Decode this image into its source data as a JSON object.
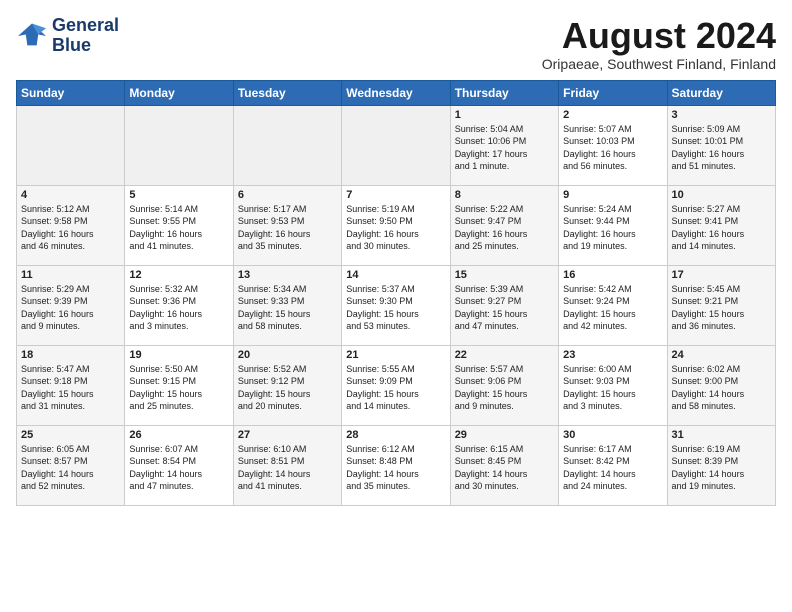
{
  "header": {
    "logo_line1": "General",
    "logo_line2": "Blue",
    "month_year": "August 2024",
    "location": "Oripaeae, Southwest Finland, Finland"
  },
  "weekdays": [
    "Sunday",
    "Monday",
    "Tuesday",
    "Wednesday",
    "Thursday",
    "Friday",
    "Saturday"
  ],
  "weeks": [
    [
      {
        "day": "",
        "info": ""
      },
      {
        "day": "",
        "info": ""
      },
      {
        "day": "",
        "info": ""
      },
      {
        "day": "",
        "info": ""
      },
      {
        "day": "1",
        "info": "Sunrise: 5:04 AM\nSunset: 10:06 PM\nDaylight: 17 hours\nand 1 minute."
      },
      {
        "day": "2",
        "info": "Sunrise: 5:07 AM\nSunset: 10:03 PM\nDaylight: 16 hours\nand 56 minutes."
      },
      {
        "day": "3",
        "info": "Sunrise: 5:09 AM\nSunset: 10:01 PM\nDaylight: 16 hours\nand 51 minutes."
      }
    ],
    [
      {
        "day": "4",
        "info": "Sunrise: 5:12 AM\nSunset: 9:58 PM\nDaylight: 16 hours\nand 46 minutes."
      },
      {
        "day": "5",
        "info": "Sunrise: 5:14 AM\nSunset: 9:55 PM\nDaylight: 16 hours\nand 41 minutes."
      },
      {
        "day": "6",
        "info": "Sunrise: 5:17 AM\nSunset: 9:53 PM\nDaylight: 16 hours\nand 35 minutes."
      },
      {
        "day": "7",
        "info": "Sunrise: 5:19 AM\nSunset: 9:50 PM\nDaylight: 16 hours\nand 30 minutes."
      },
      {
        "day": "8",
        "info": "Sunrise: 5:22 AM\nSunset: 9:47 PM\nDaylight: 16 hours\nand 25 minutes."
      },
      {
        "day": "9",
        "info": "Sunrise: 5:24 AM\nSunset: 9:44 PM\nDaylight: 16 hours\nand 19 minutes."
      },
      {
        "day": "10",
        "info": "Sunrise: 5:27 AM\nSunset: 9:41 PM\nDaylight: 16 hours\nand 14 minutes."
      }
    ],
    [
      {
        "day": "11",
        "info": "Sunrise: 5:29 AM\nSunset: 9:39 PM\nDaylight: 16 hours\nand 9 minutes."
      },
      {
        "day": "12",
        "info": "Sunrise: 5:32 AM\nSunset: 9:36 PM\nDaylight: 16 hours\nand 3 minutes."
      },
      {
        "day": "13",
        "info": "Sunrise: 5:34 AM\nSunset: 9:33 PM\nDaylight: 15 hours\nand 58 minutes."
      },
      {
        "day": "14",
        "info": "Sunrise: 5:37 AM\nSunset: 9:30 PM\nDaylight: 15 hours\nand 53 minutes."
      },
      {
        "day": "15",
        "info": "Sunrise: 5:39 AM\nSunset: 9:27 PM\nDaylight: 15 hours\nand 47 minutes."
      },
      {
        "day": "16",
        "info": "Sunrise: 5:42 AM\nSunset: 9:24 PM\nDaylight: 15 hours\nand 42 minutes."
      },
      {
        "day": "17",
        "info": "Sunrise: 5:45 AM\nSunset: 9:21 PM\nDaylight: 15 hours\nand 36 minutes."
      }
    ],
    [
      {
        "day": "18",
        "info": "Sunrise: 5:47 AM\nSunset: 9:18 PM\nDaylight: 15 hours\nand 31 minutes."
      },
      {
        "day": "19",
        "info": "Sunrise: 5:50 AM\nSunset: 9:15 PM\nDaylight: 15 hours\nand 25 minutes."
      },
      {
        "day": "20",
        "info": "Sunrise: 5:52 AM\nSunset: 9:12 PM\nDaylight: 15 hours\nand 20 minutes."
      },
      {
        "day": "21",
        "info": "Sunrise: 5:55 AM\nSunset: 9:09 PM\nDaylight: 15 hours\nand 14 minutes."
      },
      {
        "day": "22",
        "info": "Sunrise: 5:57 AM\nSunset: 9:06 PM\nDaylight: 15 hours\nand 9 minutes."
      },
      {
        "day": "23",
        "info": "Sunrise: 6:00 AM\nSunset: 9:03 PM\nDaylight: 15 hours\nand 3 minutes."
      },
      {
        "day": "24",
        "info": "Sunrise: 6:02 AM\nSunset: 9:00 PM\nDaylight: 14 hours\nand 58 minutes."
      }
    ],
    [
      {
        "day": "25",
        "info": "Sunrise: 6:05 AM\nSunset: 8:57 PM\nDaylight: 14 hours\nand 52 minutes."
      },
      {
        "day": "26",
        "info": "Sunrise: 6:07 AM\nSunset: 8:54 PM\nDaylight: 14 hours\nand 47 minutes."
      },
      {
        "day": "27",
        "info": "Sunrise: 6:10 AM\nSunset: 8:51 PM\nDaylight: 14 hours\nand 41 minutes."
      },
      {
        "day": "28",
        "info": "Sunrise: 6:12 AM\nSunset: 8:48 PM\nDaylight: 14 hours\nand 35 minutes."
      },
      {
        "day": "29",
        "info": "Sunrise: 6:15 AM\nSunset: 8:45 PM\nDaylight: 14 hours\nand 30 minutes."
      },
      {
        "day": "30",
        "info": "Sunrise: 6:17 AM\nSunset: 8:42 PM\nDaylight: 14 hours\nand 24 minutes."
      },
      {
        "day": "31",
        "info": "Sunrise: 6:19 AM\nSunset: 8:39 PM\nDaylight: 14 hours\nand 19 minutes."
      }
    ]
  ]
}
